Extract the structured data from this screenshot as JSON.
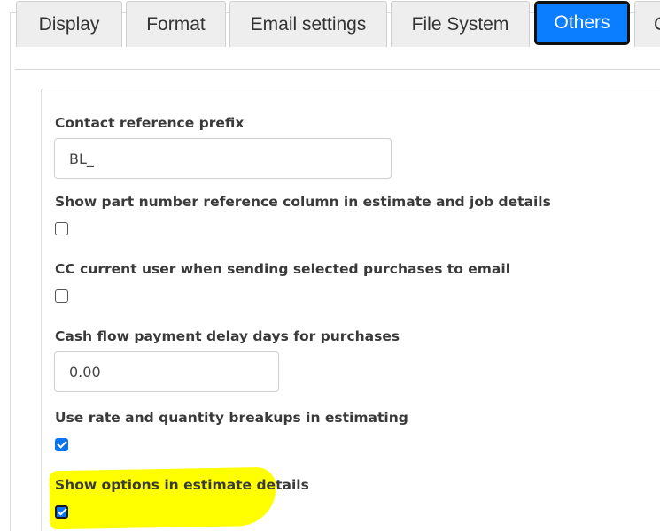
{
  "tabs": [
    {
      "label": "Display",
      "active": false
    },
    {
      "label": "Format",
      "active": false
    },
    {
      "label": "Email settings",
      "active": false
    },
    {
      "label": "File System",
      "active": false
    },
    {
      "label": "Others",
      "active": true
    },
    {
      "label": "C",
      "active": false
    }
  ],
  "fields": {
    "contact_prefix": {
      "label": "Contact reference prefix",
      "value": "BL_"
    },
    "show_part_number": {
      "label": "Show part number reference column in estimate and job details",
      "checked": false
    },
    "cc_current_user": {
      "label": "CC current user when sending selected purchases to email",
      "checked": false
    },
    "cash_flow_delay": {
      "label": "Cash flow payment delay days for purchases",
      "value": "0.00"
    },
    "use_rate_quantity": {
      "label": "Use rate and quantity breakups in estimating",
      "checked": true
    },
    "show_options": {
      "label": "Show options in estimate details",
      "checked": true
    }
  },
  "colors": {
    "accent": "#0b7dff",
    "highlight": "#ffff00"
  }
}
